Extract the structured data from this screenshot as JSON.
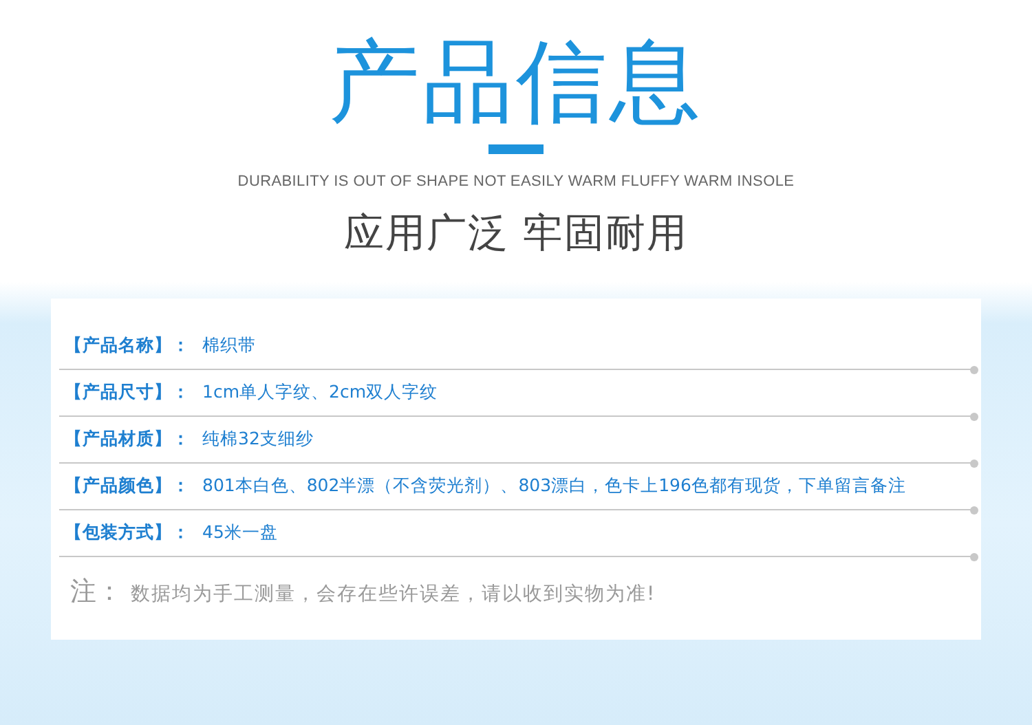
{
  "header": {
    "title": "产品信息",
    "subtitle": "DURABILITY IS OUT OF SHAPE NOT EASILY WARM FLUFFY WARM INSOLE",
    "slogan": "应用广泛 牢固耐用"
  },
  "specs": [
    {
      "label": "【产品名称】：",
      "value": "棉织带"
    },
    {
      "label": "【产品尺寸】：",
      "value": "1cm单人字纹、2cm双人字纹"
    },
    {
      "label": "【产品材质】：",
      "value": "纯棉32支细纱"
    },
    {
      "label": "【产品颜色】：",
      "value": "801本白色、802半漂（不含荧光剂）、803漂白，色卡上196色都有现货，下单留言备注"
    },
    {
      "label": "【包装方式】：",
      "value": "45米一盘"
    }
  ],
  "note": {
    "label": "注：",
    "text": "数据均为手工测量，会存在些许误差，请以收到实物为准!"
  }
}
